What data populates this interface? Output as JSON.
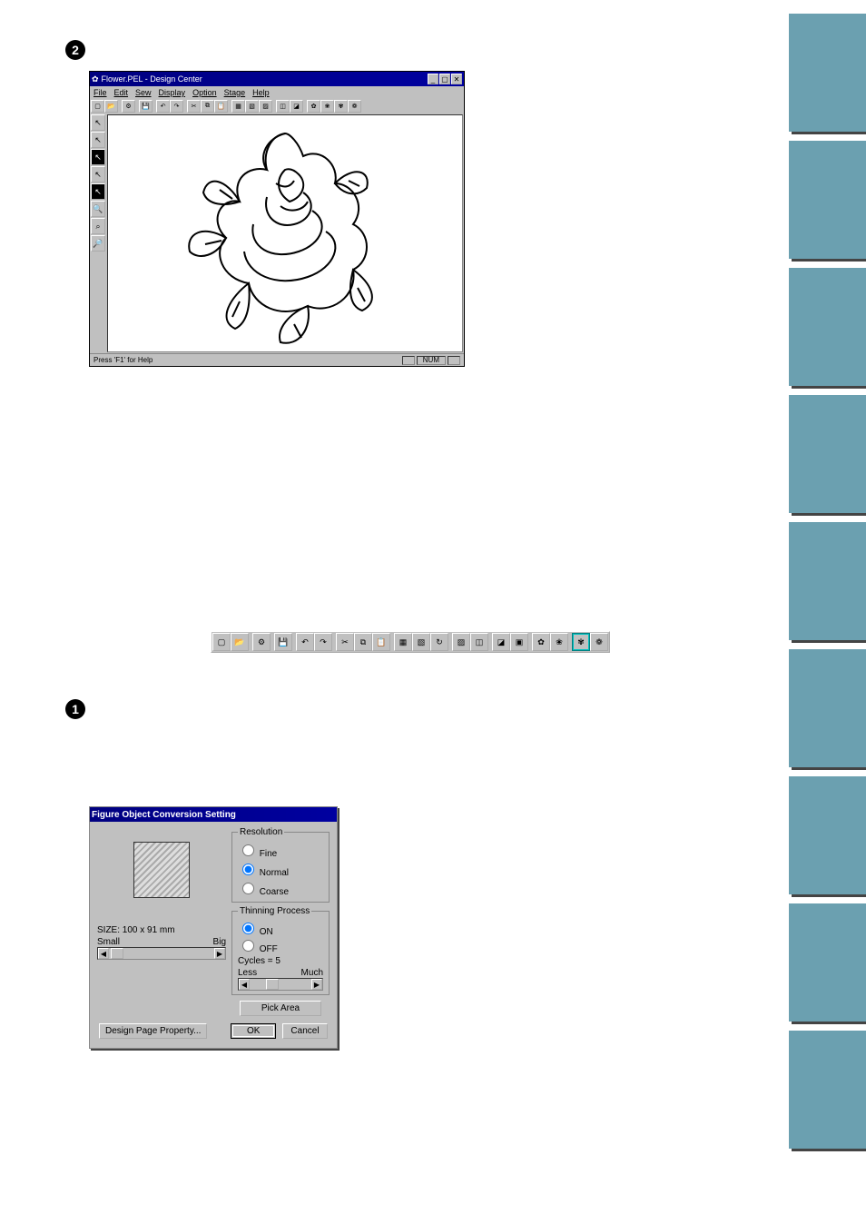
{
  "step2": "2",
  "step1": "1",
  "side_tabs_count": 9,
  "window1": {
    "title": "Flower.PEL - Design Center",
    "menu": [
      "File",
      "Edit",
      "Sew",
      "Display",
      "Option",
      "Stage",
      "Help"
    ],
    "status": "Press 'F1' for Help",
    "pane_num": "NUM",
    "toolbar": [
      "new",
      "open",
      "|",
      "net",
      "|",
      "save",
      "|",
      "undo",
      "redo",
      "|",
      "cut",
      "copy",
      "paste",
      "|",
      "a1",
      "a2",
      "a3",
      "|",
      "b1",
      "b2",
      "|",
      "c1",
      "c2",
      "c3",
      "c4"
    ],
    "side_tools": [
      "t1",
      "t2",
      "t3",
      "t4",
      "t5",
      "zoom-in",
      "zoom-fit",
      "zoom-out"
    ]
  },
  "toolbar2": [
    "new",
    "open",
    "|",
    "net",
    "|",
    "save",
    "|",
    "undo",
    "redo",
    "|",
    "cut",
    "copy",
    "paste",
    "|",
    "d1",
    "d2",
    "d3",
    "|",
    "e1",
    "e2",
    "|",
    "e3",
    "e4",
    "|",
    "f1",
    "f2",
    "|",
    "sel",
    "f3"
  ],
  "dialog": {
    "title": "Figure Object Conversion Setting",
    "resolution": {
      "legend": "Resolution",
      "options": [
        "Fine",
        "Normal",
        "Coarse"
      ],
      "selected": "Normal"
    },
    "thinning": {
      "legend": "Thinning Process",
      "options": [
        "ON",
        "OFF"
      ],
      "selected": "ON"
    },
    "cycles_label": "Cycles = 5",
    "cycles_min": "Less",
    "cycles_max": "Much",
    "size_label": "SIZE:  100 x  91 mm",
    "size_min": "Small",
    "size_max": "Big",
    "pick_area": "Pick Area",
    "design_page": "Design Page Property...",
    "ok": "OK",
    "cancel": "Cancel"
  }
}
